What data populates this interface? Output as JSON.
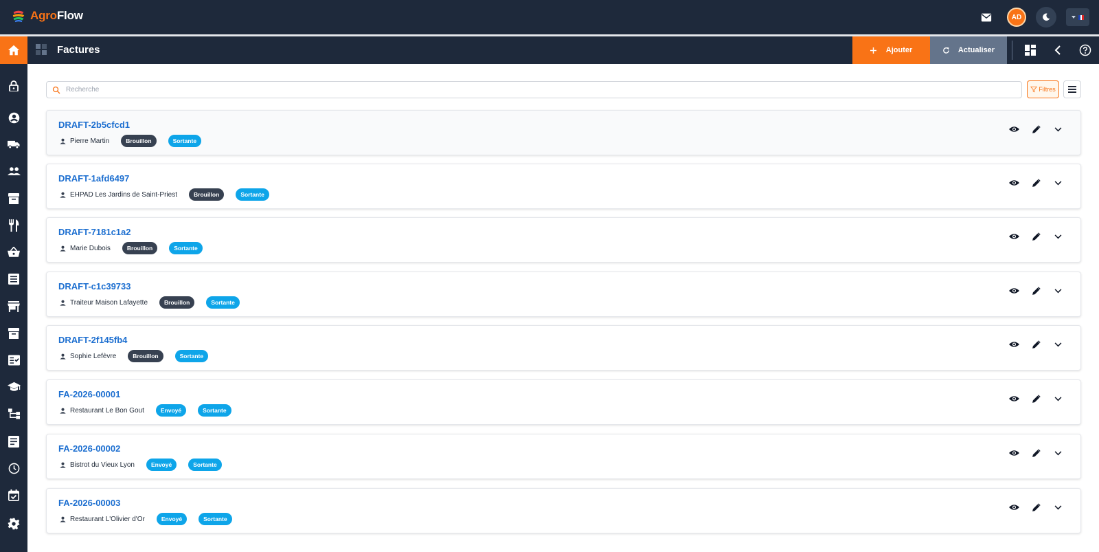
{
  "brand": {
    "part1": "Agro",
    "part2": "Flow"
  },
  "header": {
    "avatar_initials": "AD"
  },
  "subbar": {
    "title": "Factures",
    "add_label": "Ajouter",
    "refresh_label": "Actualiser"
  },
  "search": {
    "placeholder": "Recherche",
    "value": ""
  },
  "filters": {
    "label": "Filtres"
  },
  "invoices": [
    {
      "number": "DRAFT-2b5cfcd1",
      "client": "Pierre Martin",
      "status": "Brouillon",
      "direction": "Sortante"
    },
    {
      "number": "DRAFT-1afd6497",
      "client": "EHPAD Les Jardins de Saint-Priest",
      "status": "Brouillon",
      "direction": "Sortante"
    },
    {
      "number": "DRAFT-7181c1a2",
      "client": "Marie Dubois",
      "status": "Brouillon",
      "direction": "Sortante"
    },
    {
      "number": "DRAFT-c1c39733",
      "client": "Traiteur Maison Lafayette",
      "status": "Brouillon",
      "direction": "Sortante"
    },
    {
      "number": "DRAFT-2f145fb4",
      "client": "Sophie Lefèvre",
      "status": "Brouillon",
      "direction": "Sortante"
    },
    {
      "number": "FA-2026-00001",
      "client": "Restaurant Le Bon Gout",
      "status": "Envoyé",
      "direction": "Sortante"
    },
    {
      "number": "FA-2026-00002",
      "client": "Bistrot du Vieux Lyon",
      "status": "Envoyé",
      "direction": "Sortante"
    },
    {
      "number": "FA-2026-00003",
      "client": "Restaurant L'Olivier d'Or",
      "status": "Envoyé",
      "direction": "Sortante"
    }
  ],
  "sidebar": {
    "items": [
      "lock-icon",
      "account-icon",
      "truck-icon",
      "people-icon",
      "archive-icon",
      "restaurant-icon",
      "basket-icon",
      "list-icon",
      "store-icon",
      "inventory-icon",
      "checklist-icon",
      "school-icon",
      "hierarchy-icon",
      "receipt-icon",
      "clock-icon",
      "calendar-check-icon",
      "settings-icon"
    ]
  },
  "colors": {
    "accent": "#f97316",
    "nav": "#1e293b",
    "link": "#1d6fd0",
    "badge_draft": "#374151",
    "badge_info": "#0ea5e9"
  }
}
